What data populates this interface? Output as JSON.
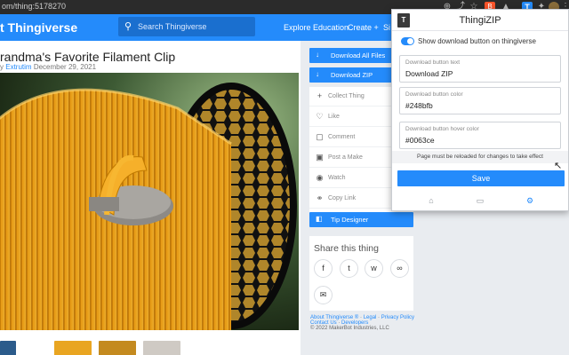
{
  "browser": {
    "url": "om/thing:5178270"
  },
  "header": {
    "logo": "t  Thingiverse",
    "search_placeholder": "Search Thingiverse",
    "nav": [
      "Explore",
      "Education",
      "Create +",
      "Si"
    ]
  },
  "thing": {
    "title": "randma's Favorite Filament Clip",
    "byline_by": "y",
    "author": "Extrutim",
    "date": "December 29, 2021"
  },
  "sidebar": {
    "download_all": "Download All Files",
    "download_zip": "Download ZIP",
    "actions": [
      {
        "icon": "+",
        "label": "Collect Thing"
      },
      {
        "icon": "♡",
        "label": "Like"
      },
      {
        "icon": "▢",
        "label": "Comment"
      },
      {
        "icon": "▣",
        "label": "Post a Make"
      },
      {
        "icon": "◉",
        "label": "Watch"
      },
      {
        "icon": "⚭",
        "label": "Copy Link"
      }
    ],
    "tip": "Tip Designer",
    "share_title": "Share this thing",
    "share_icons": [
      "f",
      "t",
      "w",
      "∞",
      "✉"
    ]
  },
  "footer": {
    "line1": [
      "About Thingiverse ®",
      "Legal",
      "Privacy Policy"
    ],
    "line2": [
      "Contact Us",
      "Developers"
    ],
    "copyright": "© 2022 MakerBot Industries, LLC"
  },
  "popup": {
    "title": "ThingiZIP",
    "toggle_label": "Show download button on thingiverse",
    "toggle_on": true,
    "fields": [
      {
        "label": "Download button text",
        "value": "Download ZIP"
      },
      {
        "label": "Download button color",
        "value": "#248bfb"
      },
      {
        "label": "Download button hover color",
        "value": "#0063ce"
      }
    ],
    "notice": "Page must be reloaded for changes to take effect",
    "save": "Save"
  },
  "colors": {
    "accent": "#248bfb",
    "hover": "#0063ce"
  }
}
